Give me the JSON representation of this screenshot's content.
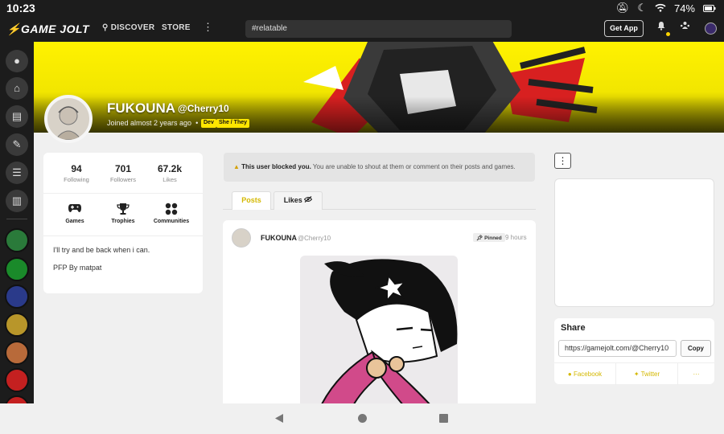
{
  "status_bar": {
    "time": "10:23",
    "battery": "74%"
  },
  "topnav": {
    "logo": "GAME JOLT",
    "discover": "DISCOVER",
    "store": "STORE",
    "search_value": "#relatable",
    "get_app": "Get App"
  },
  "profile": {
    "name": "FUKOUNA",
    "handle": "@Cherry10",
    "joined": "Joined almost 2 years ago",
    "tags": [
      "Dev",
      "She / They"
    ],
    "stats": [
      {
        "value": "94",
        "label": "Following"
      },
      {
        "value": "701",
        "label": "Followers"
      },
      {
        "value": "67.2k",
        "label": "Likes"
      }
    ],
    "categories": [
      {
        "label": "Games",
        "icon": "gamepad-icon"
      },
      {
        "label": "Trophies",
        "icon": "trophy-icon"
      },
      {
        "label": "Communities",
        "icon": "communities-icon"
      }
    ],
    "bio": [
      "I'll try and be back when i can.",
      "PFP By matpat"
    ]
  },
  "blocked_notice": {
    "strong": "This user blocked you.",
    "text": " You are unable to shout at them or comment on their posts and games."
  },
  "tabs": [
    {
      "label": "Posts"
    },
    {
      "label": "Likes"
    }
  ],
  "post": {
    "author": "FUKOUNA",
    "handle": "@Cherry10",
    "pinned": "Pinned",
    "time": "9 hours"
  },
  "share": {
    "title": "Share",
    "url": "https://gamejolt.com/@Cherry10",
    "copy": "Copy",
    "facebook": "Facebook",
    "twitter": "Twitter",
    "more": "···"
  },
  "colors": {
    "accent": "#ffe600",
    "dark": "#1c1c1c",
    "brand_yellow": "#d4b800"
  }
}
